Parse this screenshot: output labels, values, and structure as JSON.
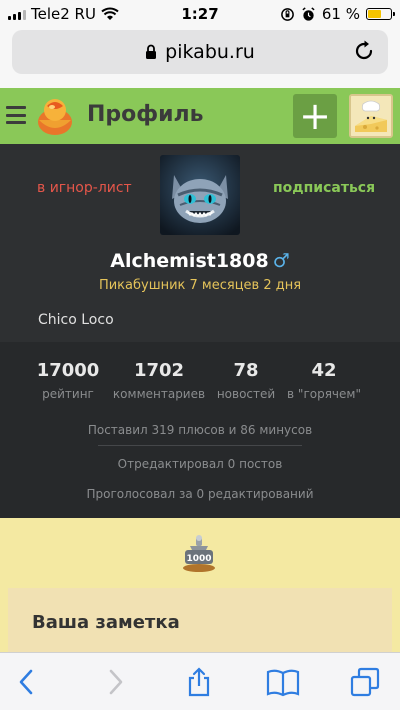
{
  "status": {
    "carrier": "Tele2 RU",
    "time": "1:27",
    "battery": "61 %"
  },
  "browser": {
    "url": "pikabu.ru"
  },
  "header": {
    "title": "Профиль",
    "plus_label": "+"
  },
  "profile": {
    "ignore_label": "в игнор-лист",
    "subscribe_label": "подписаться",
    "username": "Alchemist1808",
    "gender_symbol": "♂",
    "since": "Пикабушник 7 месяцев 2 дня",
    "about": "Chico Loco"
  },
  "stats": {
    "items": [
      {
        "value": "17000",
        "label": "рейтинг"
      },
      {
        "value": "1702",
        "label": "комментариев"
      },
      {
        "value": "78",
        "label": "новостей"
      },
      {
        "value": "42",
        "label": "в \"горячем\""
      }
    ],
    "votes": "Поставил 319 плюсов и 86 минусов",
    "edited": "Отредактировал 0 постов",
    "voted_edits": "Проголосовал за 0 редактирований"
  },
  "awards": {
    "badge_text": "1000"
  },
  "note": {
    "title": "Ваша заметка"
  },
  "colors": {
    "header_green": "#8ac858",
    "danger": "#e4564a",
    "link_blue": "#2f7de1"
  }
}
